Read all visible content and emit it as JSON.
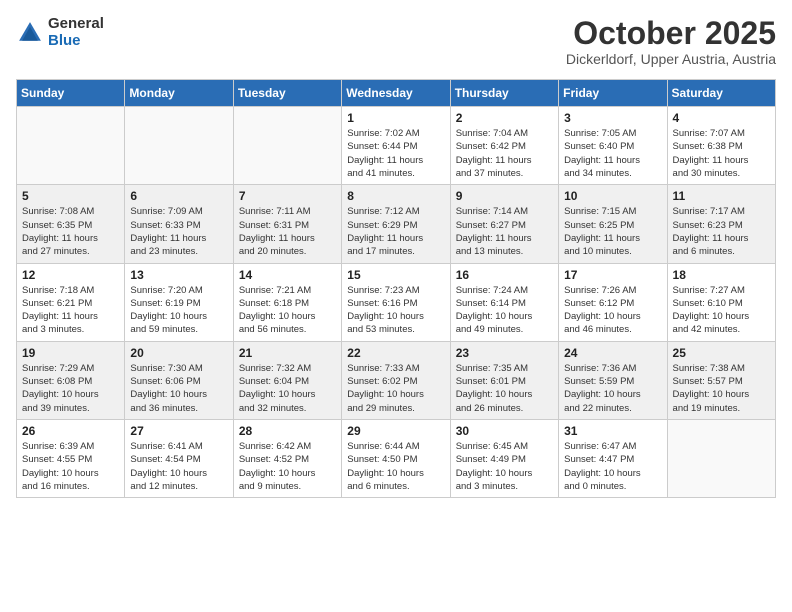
{
  "header": {
    "logo_general": "General",
    "logo_blue": "Blue",
    "month_title": "October 2025",
    "location": "Dickerldorf, Upper Austria, Austria"
  },
  "weekdays": [
    "Sunday",
    "Monday",
    "Tuesday",
    "Wednesday",
    "Thursday",
    "Friday",
    "Saturday"
  ],
  "weeks": [
    {
      "shaded": false,
      "days": [
        {
          "num": "",
          "info": ""
        },
        {
          "num": "",
          "info": ""
        },
        {
          "num": "",
          "info": ""
        },
        {
          "num": "1",
          "info": "Sunrise: 7:02 AM\nSunset: 6:44 PM\nDaylight: 11 hours\nand 41 minutes."
        },
        {
          "num": "2",
          "info": "Sunrise: 7:04 AM\nSunset: 6:42 PM\nDaylight: 11 hours\nand 37 minutes."
        },
        {
          "num": "3",
          "info": "Sunrise: 7:05 AM\nSunset: 6:40 PM\nDaylight: 11 hours\nand 34 minutes."
        },
        {
          "num": "4",
          "info": "Sunrise: 7:07 AM\nSunset: 6:38 PM\nDaylight: 11 hours\nand 30 minutes."
        }
      ]
    },
    {
      "shaded": true,
      "days": [
        {
          "num": "5",
          "info": "Sunrise: 7:08 AM\nSunset: 6:35 PM\nDaylight: 11 hours\nand 27 minutes."
        },
        {
          "num": "6",
          "info": "Sunrise: 7:09 AM\nSunset: 6:33 PM\nDaylight: 11 hours\nand 23 minutes."
        },
        {
          "num": "7",
          "info": "Sunrise: 7:11 AM\nSunset: 6:31 PM\nDaylight: 11 hours\nand 20 minutes."
        },
        {
          "num": "8",
          "info": "Sunrise: 7:12 AM\nSunset: 6:29 PM\nDaylight: 11 hours\nand 17 minutes."
        },
        {
          "num": "9",
          "info": "Sunrise: 7:14 AM\nSunset: 6:27 PM\nDaylight: 11 hours\nand 13 minutes."
        },
        {
          "num": "10",
          "info": "Sunrise: 7:15 AM\nSunset: 6:25 PM\nDaylight: 11 hours\nand 10 minutes."
        },
        {
          "num": "11",
          "info": "Sunrise: 7:17 AM\nSunset: 6:23 PM\nDaylight: 11 hours\nand 6 minutes."
        }
      ]
    },
    {
      "shaded": false,
      "days": [
        {
          "num": "12",
          "info": "Sunrise: 7:18 AM\nSunset: 6:21 PM\nDaylight: 11 hours\nand 3 minutes."
        },
        {
          "num": "13",
          "info": "Sunrise: 7:20 AM\nSunset: 6:19 PM\nDaylight: 10 hours\nand 59 minutes."
        },
        {
          "num": "14",
          "info": "Sunrise: 7:21 AM\nSunset: 6:18 PM\nDaylight: 10 hours\nand 56 minutes."
        },
        {
          "num": "15",
          "info": "Sunrise: 7:23 AM\nSunset: 6:16 PM\nDaylight: 10 hours\nand 53 minutes."
        },
        {
          "num": "16",
          "info": "Sunrise: 7:24 AM\nSunset: 6:14 PM\nDaylight: 10 hours\nand 49 minutes."
        },
        {
          "num": "17",
          "info": "Sunrise: 7:26 AM\nSunset: 6:12 PM\nDaylight: 10 hours\nand 46 minutes."
        },
        {
          "num": "18",
          "info": "Sunrise: 7:27 AM\nSunset: 6:10 PM\nDaylight: 10 hours\nand 42 minutes."
        }
      ]
    },
    {
      "shaded": true,
      "days": [
        {
          "num": "19",
          "info": "Sunrise: 7:29 AM\nSunset: 6:08 PM\nDaylight: 10 hours\nand 39 minutes."
        },
        {
          "num": "20",
          "info": "Sunrise: 7:30 AM\nSunset: 6:06 PM\nDaylight: 10 hours\nand 36 minutes."
        },
        {
          "num": "21",
          "info": "Sunrise: 7:32 AM\nSunset: 6:04 PM\nDaylight: 10 hours\nand 32 minutes."
        },
        {
          "num": "22",
          "info": "Sunrise: 7:33 AM\nSunset: 6:02 PM\nDaylight: 10 hours\nand 29 minutes."
        },
        {
          "num": "23",
          "info": "Sunrise: 7:35 AM\nSunset: 6:01 PM\nDaylight: 10 hours\nand 26 minutes."
        },
        {
          "num": "24",
          "info": "Sunrise: 7:36 AM\nSunset: 5:59 PM\nDaylight: 10 hours\nand 22 minutes."
        },
        {
          "num": "25",
          "info": "Sunrise: 7:38 AM\nSunset: 5:57 PM\nDaylight: 10 hours\nand 19 minutes."
        }
      ]
    },
    {
      "shaded": false,
      "days": [
        {
          "num": "26",
          "info": "Sunrise: 6:39 AM\nSunset: 4:55 PM\nDaylight: 10 hours\nand 16 minutes."
        },
        {
          "num": "27",
          "info": "Sunrise: 6:41 AM\nSunset: 4:54 PM\nDaylight: 10 hours\nand 12 minutes."
        },
        {
          "num": "28",
          "info": "Sunrise: 6:42 AM\nSunset: 4:52 PM\nDaylight: 10 hours\nand 9 minutes."
        },
        {
          "num": "29",
          "info": "Sunrise: 6:44 AM\nSunset: 4:50 PM\nDaylight: 10 hours\nand 6 minutes."
        },
        {
          "num": "30",
          "info": "Sunrise: 6:45 AM\nSunset: 4:49 PM\nDaylight: 10 hours\nand 3 minutes."
        },
        {
          "num": "31",
          "info": "Sunrise: 6:47 AM\nSunset: 4:47 PM\nDaylight: 10 hours\nand 0 minutes."
        },
        {
          "num": "",
          "info": ""
        }
      ]
    }
  ]
}
